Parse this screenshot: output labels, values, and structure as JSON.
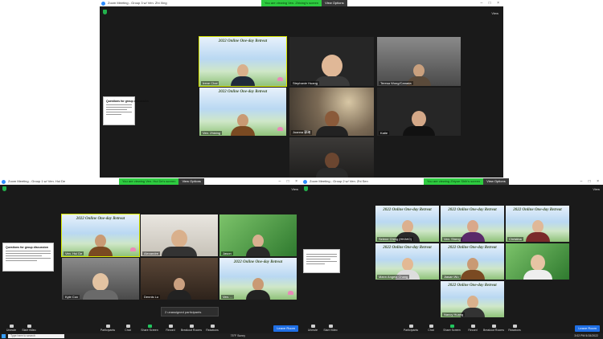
{
  "top_window": {
    "title": "Zoom Meeting - Group 3 w/ Ven. Zhi Xing",
    "viewing_banner": "You are viewing Ven. Zhixing's screen",
    "view_options": "View Options",
    "view_button": "View",
    "shared_doc_title": "Questions for group discussion",
    "participants": [
      {
        "name": "Irene Chai"
      },
      {
        "name": "Stephanie Huang"
      },
      {
        "name": "Teresa Wong/Canada"
      },
      {
        "name": "Ven. Zhixing"
      },
      {
        "name": "Joanna 郭琦"
      },
      {
        "name": "Katie"
      },
      {
        "name": ""
      }
    ],
    "retreat_banner": "2022 Online One-day Retreat"
  },
  "left_window": {
    "title": "Zoom Meeting - Group 1 w/ Ven. Hui De",
    "viewing_banner": "You are viewing Ven. Hui De's screen",
    "view_options": "View Options",
    "view_button": "View",
    "shared_doc_title": "Questions for group discussion",
    "unassigned": "2 unassigned participants",
    "participants": [
      {
        "name": "Ven. Hui De"
      },
      {
        "name": "Alexandre"
      },
      {
        "name": "Jason"
      },
      {
        "name": "Kyle Cox"
      },
      {
        "name": "Dennis Lu"
      },
      {
        "name": "Ven. ..."
      }
    ],
    "toolbar": {
      "unmute": "Unmute",
      "start_video": "Start Video",
      "participants": "Participants",
      "chat": "Chat",
      "share_screen": "Share Screen",
      "record": "Record",
      "breakout_rooms": "Breakout Rooms",
      "reactions": "Reactions",
      "leave_room": "Leave Room"
    }
  },
  "right_window": {
    "title": "Zoom Meeting - Group 2 w/ Ven. Zhi Sen",
    "viewing_banner": "You are viewing Zhiyue Shih's screen",
    "view_options": "View Options",
    "view_button": "View",
    "participants": [
      {
        "name": "Selene Ching (HK/MO)"
      },
      {
        "name": "Ven. Sheng"
      },
      {
        "name": "Christina"
      },
      {
        "name": "Mann Angela Chang"
      },
      {
        "name": "Jiasan Wu"
      },
      {
        "name": ""
      },
      {
        "name": "Nancy Huang"
      }
    ],
    "toolbar": {
      "unmute": "Unmute",
      "start_video": "Start Video",
      "participants": "Participants",
      "chat": "Chat",
      "share_screen": "Share Screen",
      "record": "Record",
      "breakout_rooms": "Breakout Rooms",
      "reactions": "Reactions",
      "leave_room": "Leave Room"
    }
  },
  "taskbar": {
    "search_placeholder": "Type here to search",
    "weather": "75°F  Sunny",
    "time": "3:02 PM",
    "date": "5/15/2022"
  },
  "colors": {
    "zoom_dark": "#1a1a1a",
    "viewing_green": "#2ecc40",
    "leave_blue": "#1f6fe5",
    "active_speaker": "#d8e600"
  }
}
